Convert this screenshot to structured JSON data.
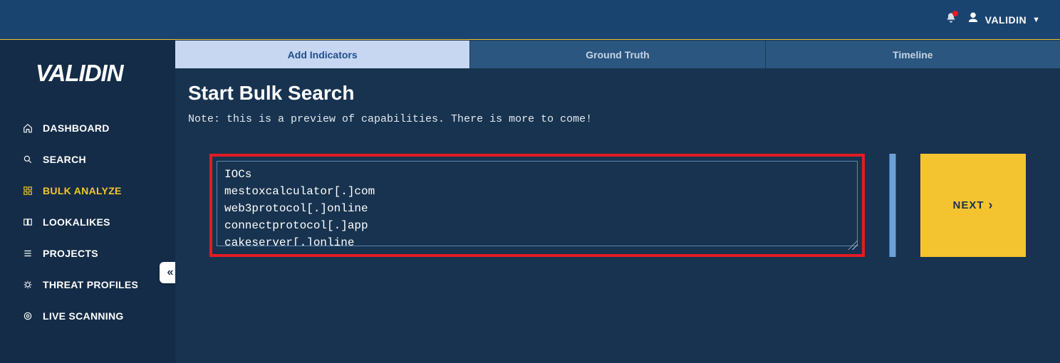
{
  "header": {
    "user_label": "VALIDIN"
  },
  "logo_text": "VALIDIN",
  "sidebar": {
    "items": [
      {
        "label": "DASHBOARD",
        "icon": "home-icon"
      },
      {
        "label": "SEARCH",
        "icon": "search-icon"
      },
      {
        "label": "BULK ANALYZE",
        "icon": "grid-icon"
      },
      {
        "label": "LOOKALIKES",
        "icon": "lookalike-icon"
      },
      {
        "label": "PROJECTS",
        "icon": "list-icon"
      },
      {
        "label": "THREAT PROFILES",
        "icon": "bug-icon"
      },
      {
        "label": "LIVE SCANNING",
        "icon": "target-icon"
      }
    ]
  },
  "tabs": [
    {
      "label": "Add Indicators"
    },
    {
      "label": "Ground Truth"
    },
    {
      "label": "Timeline"
    }
  ],
  "page": {
    "title": "Start Bulk Search",
    "note": "Note: this is a preview of capabilities. There is more to come!",
    "textarea_value": "IOCs\nmestoxcalculator[.]com\nweb3protocol[.]online\nconnectprotocol[.]app\ncakeserver[.]online",
    "next_label": "NEXT"
  }
}
